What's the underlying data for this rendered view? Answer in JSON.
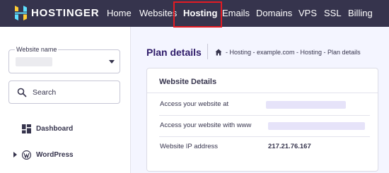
{
  "brand": {
    "name": "HOSTINGER"
  },
  "nav": {
    "items": [
      {
        "label": "Home"
      },
      {
        "label": "Websites"
      },
      {
        "label": "Hosting",
        "active": true
      },
      {
        "label": "Emails"
      },
      {
        "label": "Domains"
      },
      {
        "label": "VPS"
      },
      {
        "label": "SSL"
      },
      {
        "label": "Billing"
      }
    ]
  },
  "sidebar": {
    "website_select": {
      "label": "Website name",
      "value": ""
    },
    "search": {
      "placeholder": "Search"
    },
    "items": [
      {
        "label": "Dashboard",
        "icon": "dashboard-icon"
      },
      {
        "label": "WordPress",
        "icon": "wordpress-icon",
        "expandable": true
      }
    ]
  },
  "main": {
    "title": "Plan details",
    "breadcrumb": "- Hosting  - example.com  - Hosting  - Plan details",
    "card": {
      "title": "Website Details",
      "rows": [
        {
          "label": "Access your website at",
          "value": ""
        },
        {
          "label": "Access your website with www",
          "value": ""
        },
        {
          "label": "Website IP address",
          "value": "217.21.76.167"
        }
      ]
    }
  },
  "colors": {
    "navbar_bg": "#36344d",
    "active_highlight": "#e31b23",
    "page_bg": "#f4f5ff",
    "title_purple": "#2f1c6a",
    "logo_blue": "#5ee0ff",
    "logo_yellow": "#ffcd35"
  }
}
